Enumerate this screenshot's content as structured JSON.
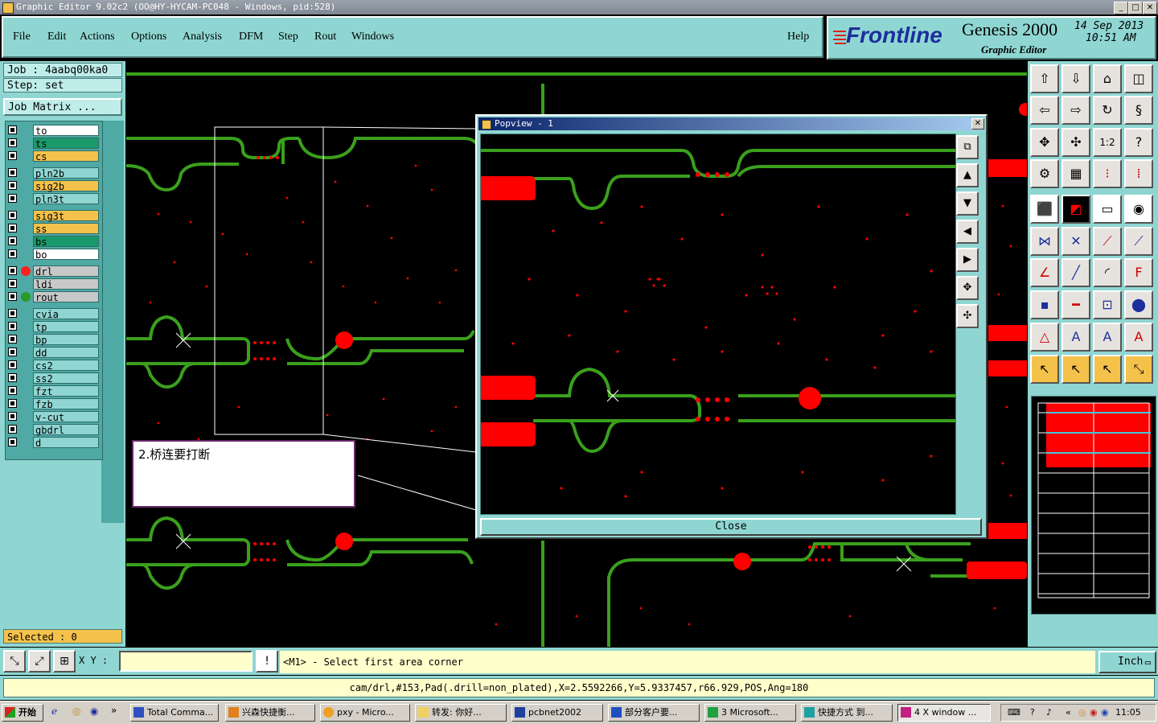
{
  "window": {
    "title": "Graphic Editor 9.02c2 (OO@HY-HYCAM-PC048 - Windows, pid:528)",
    "minimize": "_",
    "maximize": "□",
    "close": "✕"
  },
  "menu": {
    "items": [
      "File",
      "Edit",
      "Actions",
      "Options",
      "Analysis",
      "DFM",
      "Step",
      "Rout",
      "Windows"
    ],
    "help": "Help"
  },
  "brand": {
    "logo": "Frontline",
    "product": "Genesis 2000",
    "subtitle": "Graphic Editor",
    "date": "14 Sep 2013",
    "time": "10:51 AM"
  },
  "left": {
    "job": "Job : 4aabq00ka0",
    "step": "Step: set",
    "matrix_button": "Job Matrix ...",
    "layers": [
      {
        "name": "to",
        "color": "#ffffff"
      },
      {
        "name": "ts",
        "color": "#1a9a6a"
      },
      {
        "name": "cs",
        "color": "#f4c24a"
      },
      {
        "name": "pln2b",
        "color": "#8fd6d2"
      },
      {
        "name": "sig2b",
        "color": "#f4c24a"
      },
      {
        "name": "pln3t",
        "color": "#8fd6d2"
      },
      {
        "name": "sig3t",
        "color": "#f4c24a"
      },
      {
        "name": "ss",
        "color": "#f4c24a"
      },
      {
        "name": "bs",
        "color": "#1a9a6a"
      },
      {
        "name": "bo",
        "color": "#ffffff"
      },
      {
        "name": "drl",
        "color": "#c8c8c8"
      },
      {
        "name": "ldi",
        "color": "#c8c8c8"
      },
      {
        "name": "rout",
        "color": "#c8c8c8"
      },
      {
        "name": "cvia",
        "color": "#8fd6d2"
      },
      {
        "name": "tp",
        "color": "#8fd6d2"
      },
      {
        "name": "bp",
        "color": "#8fd6d2"
      },
      {
        "name": "dd",
        "color": "#8fd6d2"
      },
      {
        "name": "cs2",
        "color": "#8fd6d2"
      },
      {
        "name": "ss2",
        "color": "#8fd6d2"
      },
      {
        "name": "fzt",
        "color": "#8fd6d2"
      },
      {
        "name": "fzb",
        "color": "#8fd6d2"
      },
      {
        "name": "v-cut",
        "color": "#8fd6d2"
      },
      {
        "name": "gbdrl",
        "color": "#8fd6d2"
      },
      {
        "name": "d",
        "color": "#8fd6d2"
      }
    ],
    "selected": "Selected : 0"
  },
  "popview": {
    "title": "Popview - 1",
    "close_label": "Close"
  },
  "annotation": {
    "text": "2.桥连要打断"
  },
  "command": {
    "xy_label": "X Y :",
    "xy_value": "",
    "prompt": "<M1> - Select first area corner",
    "unit": "Inch"
  },
  "status": {
    "text": "cam/drl,#153,Pad(.drill=non_plated),X=2.5592266,Y=5.9337457,r66.929,POS,Ang=180"
  },
  "taskbar": {
    "start": "开始",
    "tasks": [
      "Total Comma...",
      "兴森快捷衡...",
      "pxy - Micro...",
      "转发: 你好...",
      "pcbnet2002",
      "部分客户要...",
      "3 Microsoft...",
      "快捷方式 到...",
      "4 X window ..."
    ],
    "clock": "11:05"
  },
  "colors": {
    "panel": "#8fd6d2",
    "trace": "#3aa01c",
    "pad": "#ff0000",
    "canvas": "#000000"
  }
}
